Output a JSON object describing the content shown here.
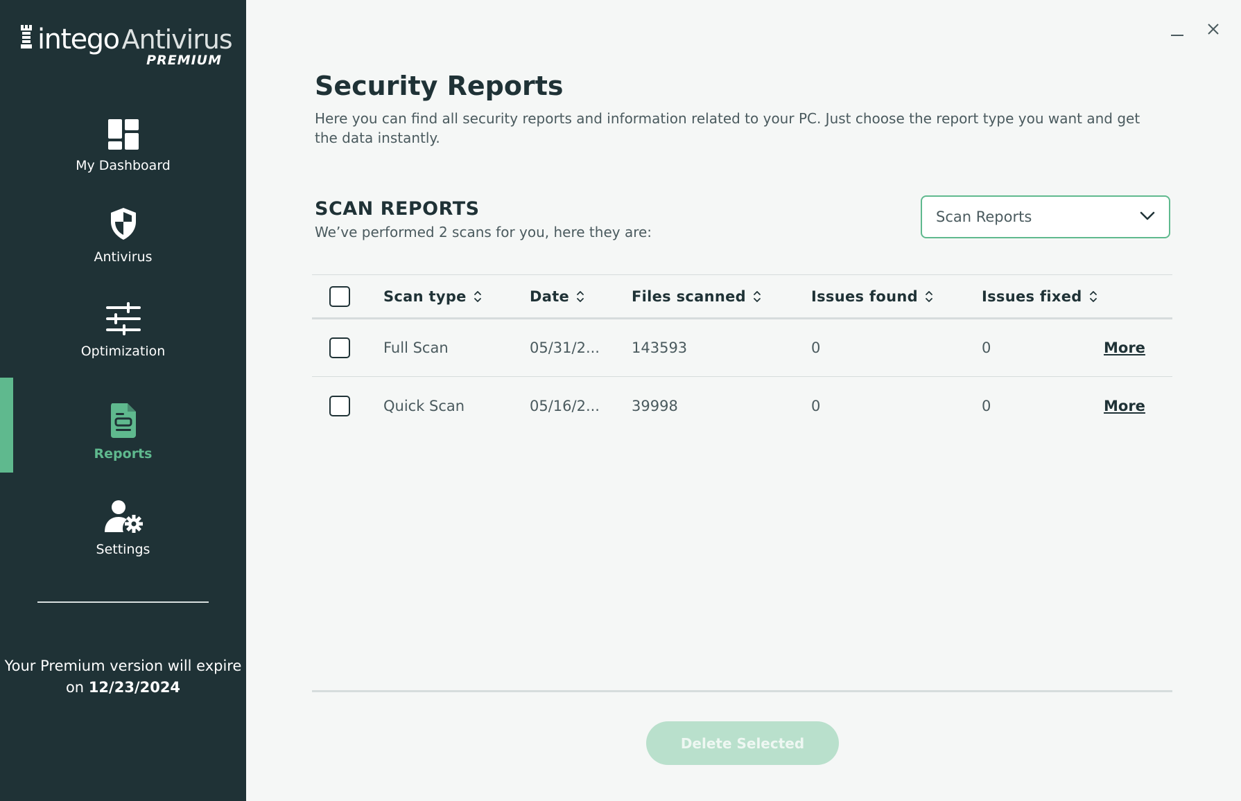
{
  "app": {
    "brand_word1": "intego",
    "brand_word2": "Antivirus",
    "tier": "PREMIUM"
  },
  "colors": {
    "sidebar_bg": "#1f3236",
    "accent": "#5fb98e",
    "main_bg": "#f5f7f6",
    "disabled_button": "#b9e0cc"
  },
  "sidebar": {
    "items": [
      {
        "label": "My Dashboard",
        "icon": "dashboard-grid-icon"
      },
      {
        "label": "Antivirus",
        "icon": "shield-icon"
      },
      {
        "label": "Optimization",
        "icon": "sliders-icon"
      },
      {
        "label": "Reports",
        "icon": "report-document-icon",
        "active": true
      },
      {
        "label": "Settings",
        "icon": "user-gear-icon"
      }
    ],
    "expiry_text": "Your Premium version will expire on",
    "expiry_date": "12/23/2024"
  },
  "window_controls": {
    "minimize_icon": "minimize-icon",
    "close_icon": "close-icon"
  },
  "main": {
    "title": "Security Reports",
    "description": "Here you can find all security reports and information related to your PC. Just choose the report type you want and get the data instantly.",
    "section_title": "SCAN REPORTS",
    "section_subtitle": "We’ve performed 2 scans for you, here they are:",
    "report_type_select": {
      "value": "Scan Reports",
      "icon": "chevron-down-icon"
    },
    "table": {
      "columns": [
        "Scan type",
        "Date",
        "Files scanned",
        "Issues found",
        "Issues fixed"
      ],
      "rows": [
        {
          "scan_type": "Full Scan",
          "date": "05/31/2...",
          "files_scanned": "143593",
          "issues_found": "0",
          "issues_fixed": "0",
          "action": "More"
        },
        {
          "scan_type": "Quick Scan",
          "date": "05/16/2...",
          "files_scanned": "39998",
          "issues_found": "0",
          "issues_fixed": "0",
          "action": "More"
        }
      ]
    },
    "delete_button": "Delete Selected"
  }
}
